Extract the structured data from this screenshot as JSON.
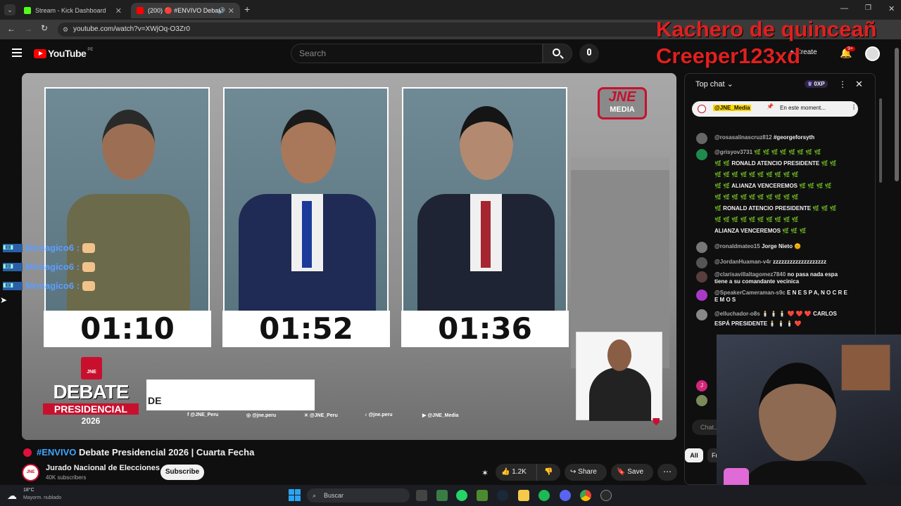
{
  "browser": {
    "tabs": [
      {
        "label": "Stream - Kick Dashboard"
      },
      {
        "label": "(200) 🔴 #ENVIVO Debate"
      }
    ],
    "url": "youtube.com/watch?v=XWjOq-O3Zr0"
  },
  "youtube": {
    "logo": "YouTube",
    "region": "PE",
    "search_placeholder": "Search",
    "create_label": "Create",
    "notif_badge": "9+"
  },
  "video": {
    "title_prefix": "#ENVIVO",
    "title": "Debate Presidencial 2026 | Cuarta Fecha",
    "timers": [
      "01:10",
      "01:52",
      "01:36"
    ],
    "brand_top": "JNE",
    "brand_bottom": "MEDIA",
    "debate_word": "DEBATE",
    "presidencial_word": "PRESIDENCIAL",
    "year": "2026",
    "lower_third_text": "DE",
    "socials": [
      "@JNE_Peru",
      "@jne.peru",
      "@JNE_Peru",
      "@jne.peru",
      "@JNE_Media"
    ]
  },
  "channel": {
    "name": "Jurado Nacional de Elecciones",
    "subscribers": "40K subscribers",
    "subscribe_label": "Subscribe",
    "likes": "1.2K",
    "share_label": "Share",
    "save_label": "Save"
  },
  "chat": {
    "header": "Top chat",
    "xp": "0XP",
    "pinned_author": "@JNE_Media",
    "pinned_text": "En este moment...",
    "messages": [
      {
        "author": "@rosasalinascruz812",
        "text": "#georgeforsyth",
        "color": "#666"
      },
      {
        "author": "@grisyov3731",
        "text": "🌿 🌿 🌿 🌿 🌿 🌿 🌿 🌿",
        "color": "#1e8a4c"
      },
      {
        "author": "",
        "text": "🌿 🌿 RONALD ATENCIO PRESIDENTE 🌿 🌿",
        "color": ""
      },
      {
        "author": "",
        "text": "🌿 🌿 🌿 🌿 🌿 🌿 🌿 🌿 🌿 🌿",
        "color": ""
      },
      {
        "author": "",
        "text": "🌿 🌿 ALIANZA VENCEREMOS 🌿 🌿 🌿 🌿",
        "color": ""
      },
      {
        "author": "",
        "text": "🌿 🌿 🌿 🌿 🌿 🌿 🌿 🌿 🌿 🌿",
        "color": ""
      },
      {
        "author": "",
        "text": "🌿 RONALD ATENCIO PRESIDENTE 🌿 🌿 🌿",
        "color": ""
      },
      {
        "author": "",
        "text": "🌿 🌿 🌿 🌿 🌿 🌿 🌿 🌿 🌿 🌿",
        "color": ""
      },
      {
        "author": "",
        "text": "ALIANZA VENCEREMOS 🌿 🌿 🌿",
        "color": ""
      },
      {
        "author": "@ronaldmateo15",
        "text": "Jorge Nieto 🌞",
        "color": "#777"
      },
      {
        "author": "@JordanHuaman-v4r",
        "text": "zzzzzzzzzzzzzzzzzzz",
        "color": "#555"
      },
      {
        "author": "@clarisavillaltagomez7840",
        "text": "no pasa nada espa tiene a su comandante vecinica",
        "color": "#5a3d3d"
      },
      {
        "author": "@SpeakerCameraman-s9c",
        "text": "E N E S P A, N O C R E E M O S",
        "color": "#a83ac7"
      },
      {
        "author": "@elluchador-o8s",
        "text": "🕯️ 🕯️ 🕯️ ❤️ ❤️ ❤️ CARLOS ESPÁ PRESIDENTE 🕯️ 🕯️ 🕯️ ❤️",
        "color": "#888"
      }
    ],
    "input_placeholder": "Chat...",
    "filter_all": "All",
    "filter_fr": "Fr"
  },
  "overlays": {
    "red_line1": "Kachero de quinceañ",
    "red_line2": "Creeper123xd",
    "user_tags": [
      "Mrmagico6 :",
      "Mrmagico6 :",
      "Mrmagico6 :"
    ]
  },
  "taskbar": {
    "temperature": "18°C",
    "weather": "Mayorm. nublado",
    "search_label": "Buscar"
  }
}
